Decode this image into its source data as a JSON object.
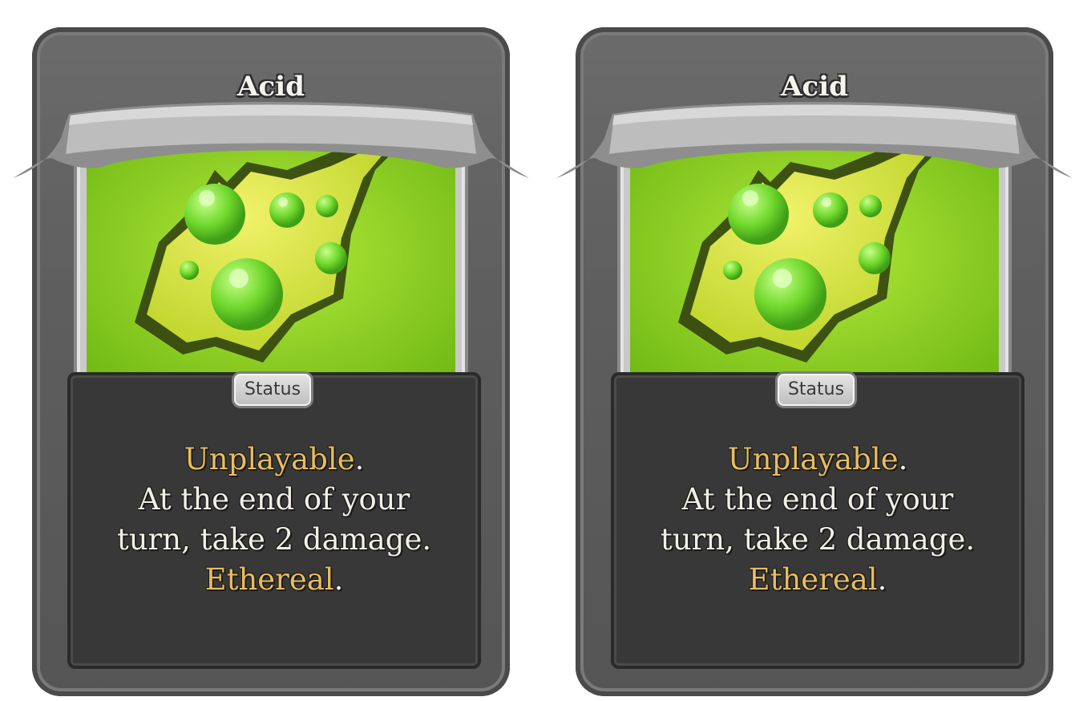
{
  "cards": [
    {
      "title": "Acid",
      "type": "Status",
      "art_icon": "acid-blob-art",
      "description": {
        "keyword1": "Unplayable",
        "line2": "At the end of your",
        "line3": "turn, take 2 damage.",
        "keyword2": "Ethereal",
        "period": "."
      }
    },
    {
      "title": "Acid",
      "type": "Status",
      "art_icon": "acid-blob-art",
      "description": {
        "keyword1": "Unplayable",
        "line2": "At the end of your",
        "line3": "turn, take 2 damage.",
        "keyword2": "Ethereal",
        "period": "."
      }
    }
  ],
  "colors": {
    "keyword": "#e8bd5c",
    "body_text": "#f2efe6",
    "art_green": "#7dc21e"
  }
}
